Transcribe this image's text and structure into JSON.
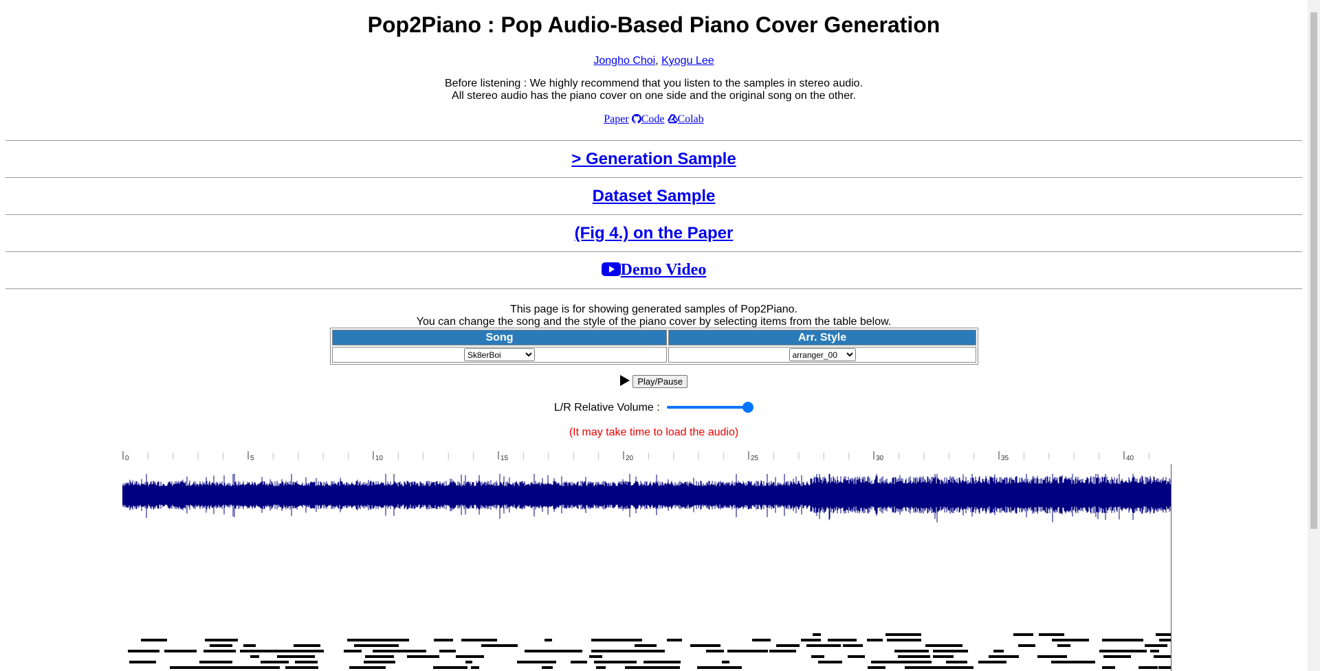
{
  "header": {
    "title": "Pop2Piano : Pop Audio-Based Piano Cover Generation",
    "authors": [
      "Jongho Choi",
      "Kyogu Lee"
    ],
    "author_sep": ", ",
    "note_line1": "Before listening : We highly recommend that you listen to the samples in stereo audio.",
    "note_line2": "All stereo audio has the piano cover on one side and the original song on the other.",
    "links": {
      "paper": "Paper",
      "code": "Code",
      "colab": "Colab"
    }
  },
  "sections": {
    "generation": "> Generation Sample",
    "dataset": "Dataset Sample",
    "fig4": "(Fig 4.) on the Paper",
    "demo": "Demo Video"
  },
  "intro": {
    "line1": "This page is for showing generated samples of Pop2Piano.",
    "line2": "You can change the song and the style of the piano cover by selecting items from the table below."
  },
  "table": {
    "col_song": "Song",
    "col_style": "Arr. Style",
    "song_value": "Sk8erBoi",
    "style_value": "arranger_00"
  },
  "player": {
    "play_label": "Play/Pause",
    "volume_label": "L/R Relative Volume :",
    "volume_level": 1.0,
    "warning": "(It may take time to load the audio)"
  },
  "timeline": {
    "ticks": [
      "0",
      "5",
      "10",
      "15",
      "20",
      "25",
      "30",
      "35",
      "40"
    ]
  },
  "colors": {
    "waveform": "#000080",
    "link": "#0000ee",
    "table_header": "#2b7bb9",
    "warning": "#e00000",
    "accent": "#0075ff"
  },
  "icons": {
    "code": "github-icon",
    "colab": "colab-icon",
    "demo": "youtube-icon",
    "play": "play-icon"
  }
}
